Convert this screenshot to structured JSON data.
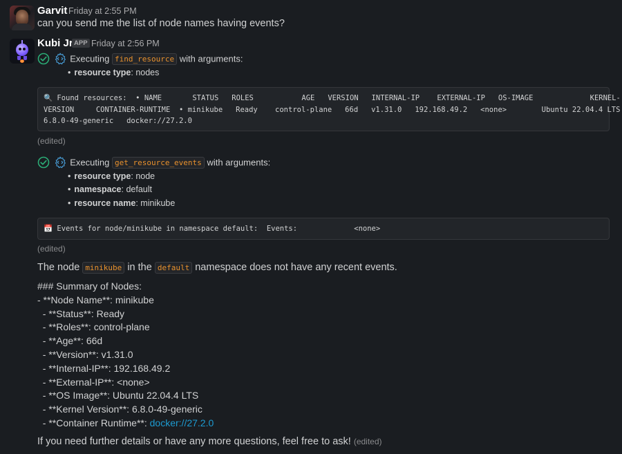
{
  "messages": {
    "garvit": {
      "name": "Garvit",
      "time": "Friday at 2:55 PM",
      "text": "can you send me the list of node names having events?"
    },
    "kubi": {
      "name": "Kubi Jr.",
      "badge": "APP",
      "time": "Friday at 2:56 PM"
    }
  },
  "exec1": {
    "prefix": "Executing",
    "tool": "find_resource",
    "suffix": "with arguments:",
    "args": [
      {
        "key": "resource type",
        "value": "nodes"
      }
    ],
    "output_lines": [
      "🔍 Found resources:  • NAME       STATUS   ROLES           AGE   VERSION   INTERNAL-IP    EXTERNAL-IP   OS-IMAGE             KERNEL-",
      "VERSION     CONTAINER-RUNTIME  • minikube   Ready    control-plane   66d   v1.31.0   192.168.49.2   <none>        Ubuntu 22.04.4 LTS",
      "6.8.0-49-generic   docker://27.2.0"
    ],
    "edited": "(edited)"
  },
  "exec2": {
    "prefix": "Executing",
    "tool": "get_resource_events",
    "suffix": "with arguments:",
    "args": [
      {
        "key": "resource type",
        "value": "node"
      },
      {
        "key": "namespace",
        "value": "default"
      },
      {
        "key": "resource name",
        "value": "minikube"
      }
    ],
    "output_lines": [
      "📅 Events for node/minikube in namespace default:  Events:             <none>"
    ],
    "edited": "(edited)"
  },
  "answer": {
    "p1_before": "The node",
    "p1_node": "minikube",
    "p1_mid": "in the",
    "p1_ns": "default",
    "p1_after": "namespace does not have any recent events.",
    "summary_lines": [
      "### Summary of Nodes:",
      "- **Node Name**: minikube",
      "  - **Status**: Ready",
      "  - **Roles**: control-plane",
      "  - **Age**: 66d",
      "  - **Version**: v1.31.0",
      "  - **Internal-IP**: 192.168.49.2",
      "  - **External-IP**: <none>",
      "  - **OS Image**: Ubuntu 22.04.4 LTS",
      "  - **Kernel Version**: 6.8.0-49-generic"
    ],
    "runtime_prefix": "  - **Container Runtime**: ",
    "runtime_link": "docker://27.2.0",
    "closing": "If you need further details or have any more questions, feel free to ask!",
    "closing_edited": "(edited)"
  },
  "colors": {
    "background": "#1a1d21",
    "inline_code": "#e8912d",
    "link": "#1d9bd1",
    "check": "#2bac76",
    "gear": "#4aa3df"
  },
  "icons": [
    "check-circle-icon",
    "gear-code-icon",
    "magnifier-icon",
    "calendar-icon"
  ]
}
